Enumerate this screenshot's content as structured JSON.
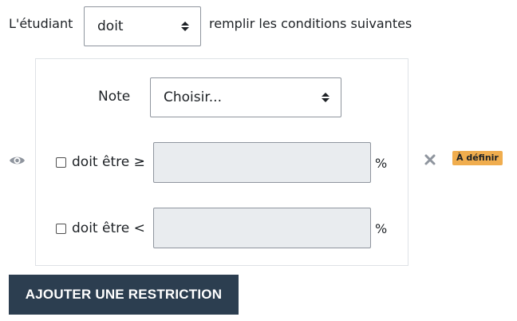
{
  "header": {
    "student_label": "L'étudiant",
    "condition_select": {
      "value": "doit"
    },
    "rest_label": "remplir les conditions suivantes"
  },
  "restriction": {
    "grade_label": "Note",
    "grade_select": {
      "value": "Choisir..."
    },
    "min": {
      "checkbox_label": "doit être ≥",
      "value": "",
      "unit": "%"
    },
    "max": {
      "checkbox_label": "doit être <",
      "value": "",
      "unit": "%"
    },
    "status_badge": "À définir",
    "icons": {
      "visibility": "eye-icon",
      "delete": "close-icon"
    },
    "colors": {
      "badge": "#f0ad4e",
      "button": "#2c3e50"
    }
  },
  "actions": {
    "add_restriction_label": "AJOUTER UNE RESTRICTION"
  }
}
